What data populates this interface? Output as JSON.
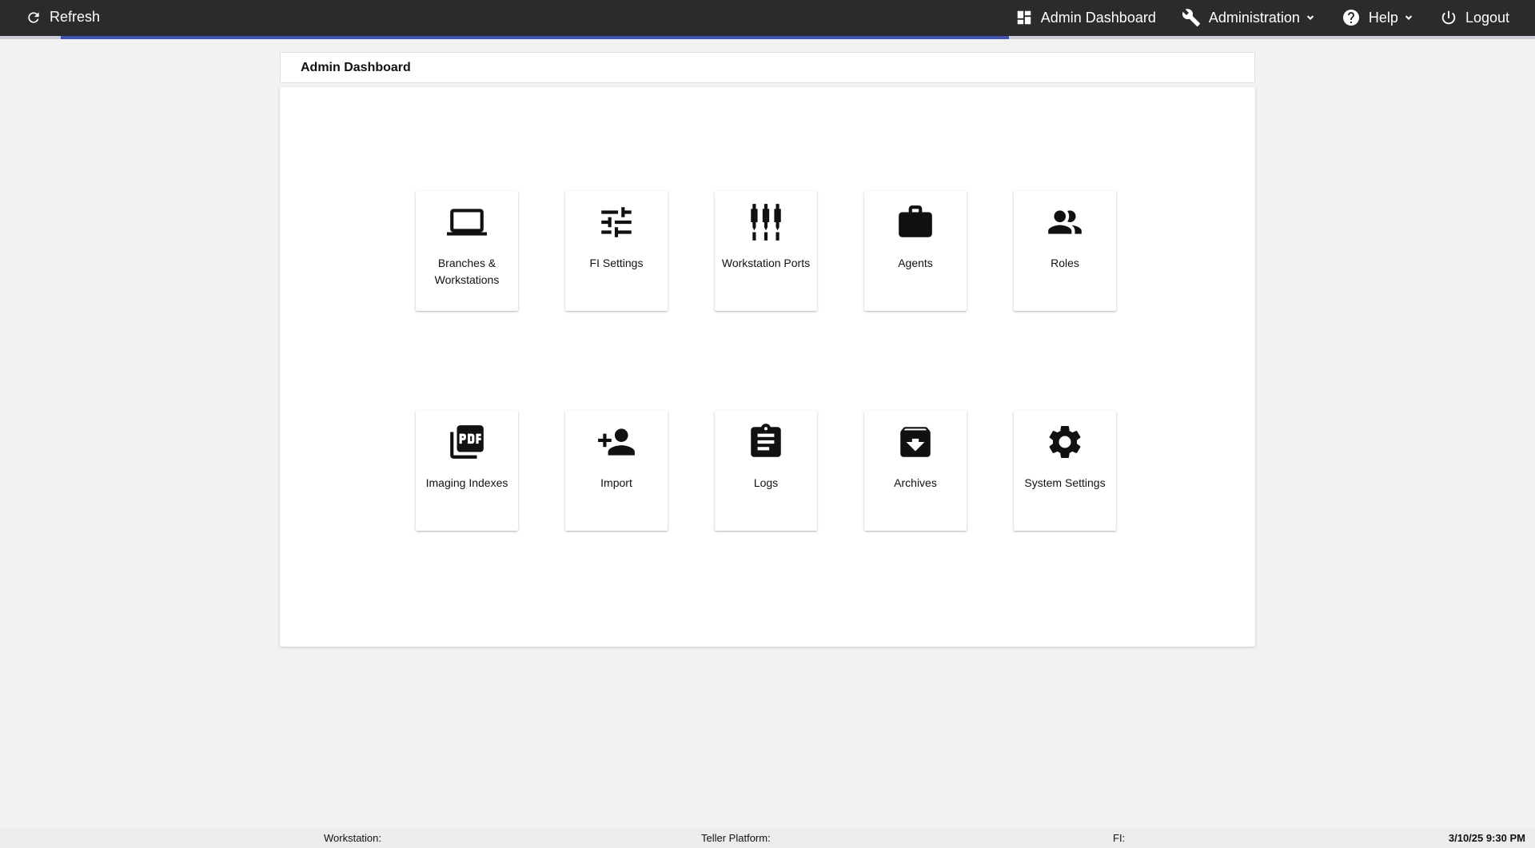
{
  "topbar": {
    "refresh_label": "Refresh",
    "nav": [
      {
        "label": "Admin Dashboard",
        "icon": "dashboard-icon"
      },
      {
        "label": "Administration",
        "icon": "wrench-icon",
        "dropdown": true
      },
      {
        "label": "Help",
        "icon": "help-circle-icon",
        "dropdown": true
      },
      {
        "label": "Logout",
        "icon": "power-icon"
      }
    ],
    "progress_fraction": 0.62
  },
  "page_title": "Admin Dashboard",
  "tiles": [
    {
      "label": "Branches & Workstations",
      "icon": "laptop-icon"
    },
    {
      "label": "FI Settings",
      "icon": "tune-icon"
    },
    {
      "label": "Workstation Ports",
      "icon": "ports-icon"
    },
    {
      "label": "Agents",
      "icon": "briefcase-icon"
    },
    {
      "label": "Roles",
      "icon": "people-icon"
    },
    {
      "label": "Imaging Indexes",
      "icon": "pdf-icon"
    },
    {
      "label": "Import",
      "icon": "person-add-icon"
    },
    {
      "label": "Logs",
      "icon": "clipboard-icon"
    },
    {
      "label": "Archives",
      "icon": "archive-icon"
    },
    {
      "label": "System Settings",
      "icon": "gear-icon"
    }
  ],
  "footer": {
    "workstation_label": "Workstation:",
    "teller_platform_label": "Teller Platform:",
    "fi_label": "FI:",
    "datetime": "3/10/25 9:30 PM"
  },
  "colors": {
    "topbar_bg": "#2b2b2b",
    "progress_accent": "#3f51b5",
    "page_bg": "#f2f2f2"
  }
}
